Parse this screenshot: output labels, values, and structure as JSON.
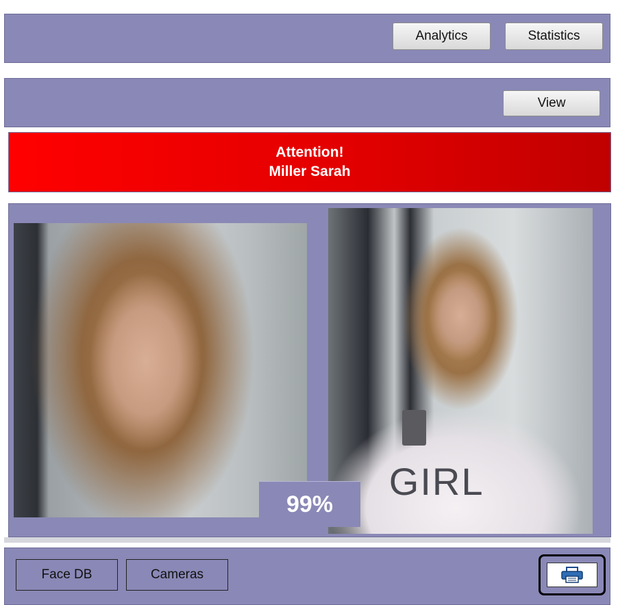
{
  "toolbar": {
    "analytics_label": "Analytics",
    "statistics_label": "Statistics",
    "view_label": "View"
  },
  "alert": {
    "title": "Attention!",
    "name": "Miller Sarah",
    "color": "#ff0000"
  },
  "match": {
    "score": "99%",
    "shirt_text": "GIRL"
  },
  "bottom": {
    "face_db_label": "Face DB",
    "cameras_label": "Cameras",
    "print_icon": "printer-icon"
  },
  "colors": {
    "panel": "#8a88b6",
    "banner": "#ff0000"
  }
}
